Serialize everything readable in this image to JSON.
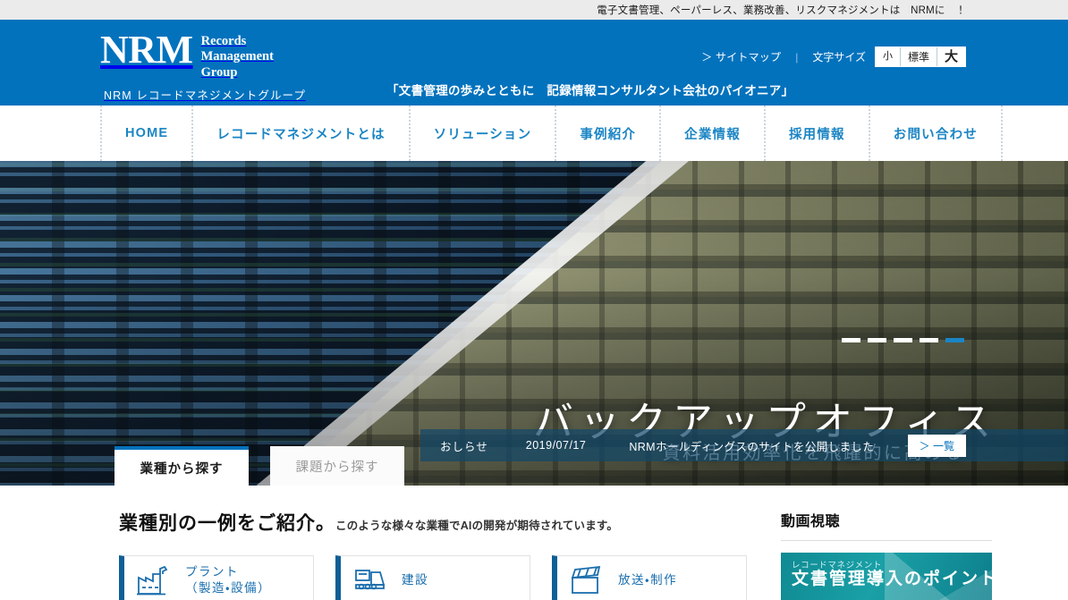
{
  "utility": {
    "text": "電子文書管理、ペーパーレス、業務改善、リスクマネジメントは　NRMに　！"
  },
  "header": {
    "logo_mark": "NRM",
    "logo_word_1": "Records",
    "logo_word_2": "Management",
    "logo_word_3": "Group",
    "logo_sub": "NRM レコードマネジメントグループ",
    "tagline": "「文書管理の歩みとともに　記録情報コンサルタント会社のパイオニア」",
    "sitemap_label": "＞ サイトマップ",
    "divider": "|",
    "fontsize_label": "文字サイズ",
    "fontsize_small": "小",
    "fontsize_normal": "標準",
    "fontsize_large": "大",
    "bg_color": "#0372bd"
  },
  "nav": {
    "items": [
      {
        "label": "HOME"
      },
      {
        "label": "レコードマネジメントとは"
      },
      {
        "label": "ソリューション"
      },
      {
        "label": "事例紹介"
      },
      {
        "label": "企業情報"
      },
      {
        "label": "採用情報"
      },
      {
        "label": "お問い合わせ"
      }
    ],
    "link_color": "#1b85c4"
  },
  "hero": {
    "title": "バックアップオフィス",
    "subtitle": "資料活用効率化を飛躍的に高める",
    "slides_total": 5,
    "active_slide": 5,
    "tab_active": "業種から探す",
    "tab_inactive": "課題から探す",
    "news_label": "おしらせ",
    "news_date": "2019/07/17",
    "news_title": "NRMホールディングスのサイトを公開しました",
    "news_more": "＞ 一覧"
  },
  "main": {
    "heading_big": "業種別の一例をご紹介。",
    "heading_small": "このような様々な業種でAIの開発が期待されています。",
    "cards": [
      {
        "label_line1": "プラント",
        "label_line2": "（製造・設備）",
        "icon": "factory-icon"
      },
      {
        "label_line1": "建設",
        "label_line2": "",
        "icon": "bulldozer-icon"
      },
      {
        "label_line1": "放送・制作",
        "label_line2": "",
        "icon": "clapperboard-icon"
      }
    ],
    "card_accent": "#0e5f96"
  },
  "sidebar": {
    "heading": "動画視聴",
    "video_small": "レコードマネジメント",
    "video_big": "文書管理導入のポイント"
  }
}
